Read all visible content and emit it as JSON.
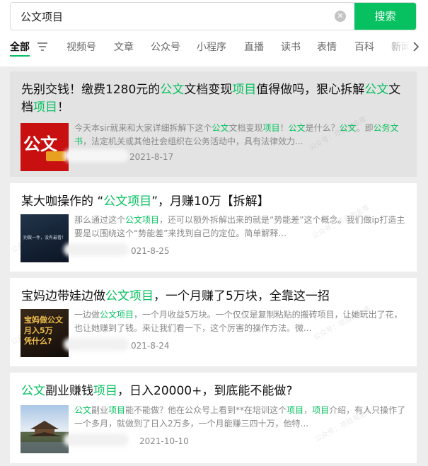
{
  "search": {
    "value": "公文项目",
    "button_label": "搜索"
  },
  "tabs": [
    "全部",
    "视频号",
    "文章",
    "公众号",
    "小程序",
    "直播",
    "读书",
    "表情",
    "百科",
    "新闻"
  ],
  "accent_color": "#07c160",
  "results": [
    {
      "title": [
        [
          "先别交钱！缴费1280元的",
          false
        ],
        [
          "公文",
          true
        ],
        [
          "文档变现",
          false
        ],
        [
          "项目",
          true
        ],
        [
          "值得做吗，狠心拆解",
          false
        ],
        [
          "公文",
          true
        ],
        [
          "文档",
          false
        ],
        [
          "项目",
          true
        ],
        [
          "！",
          false
        ]
      ],
      "desc": [
        [
          "今天本sir就来和大家详细拆解下这个",
          false
        ],
        [
          "公文",
          true
        ],
        [
          "文档变现",
          false
        ],
        [
          "项目",
          true
        ],
        [
          "！",
          false
        ],
        [
          "公文",
          true
        ],
        [
          "是什么？",
          false
        ],
        [
          "公文",
          true
        ],
        [
          "。即",
          false
        ],
        [
          "公务文书",
          true
        ],
        [
          "，法定机关或其他社会组织在公务活动中，具有法律效力...",
          false
        ]
      ],
      "date": "2021-8-17",
      "thumb_text": "公文"
    },
    {
      "title": [
        [
          "某大咖操作的 “",
          false
        ],
        [
          "公文项目",
          true
        ],
        [
          "”，月赚10万【拆解】",
          false
        ]
      ],
      "desc": [
        [
          "那么通过这个",
          false
        ],
        [
          "公文项目",
          true
        ],
        [
          "，还可以额外拆解出来的就是“势能差”这个概念。我们做ip打造主要是以围绕这个“势能差”来找到自己的定位。简单解释...",
          false
        ]
      ],
      "date": "021-8-25",
      "thumb_text": "别做一件，没有最看！"
    },
    {
      "title": [
        [
          "宝妈边带娃边做",
          false
        ],
        [
          "公文项目",
          true
        ],
        [
          "，一个月赚了5万块，全靠这一招",
          false
        ]
      ],
      "desc": [
        [
          "一边做",
          false
        ],
        [
          "公文项目",
          true
        ],
        [
          "，一个月收益5万块。一个仅仅是复制粘贴的搬砖项目，让她玩出了花，也让她赚到了钱。来让我们看一下，这个厉害的操作方法。微...",
          false
        ]
      ],
      "date": "021-8-24",
      "thumb_text": "宝妈做公文\n月入5万\n凭什么?"
    },
    {
      "title": [
        [
          "公文",
          true
        ],
        [
          "副业赚钱",
          false
        ],
        [
          "项目",
          true
        ],
        [
          "，日入20000+，到底能不能做?",
          false
        ]
      ],
      "desc": [
        [
          "公文",
          true
        ],
        [
          "副业",
          false
        ],
        [
          "项目",
          true
        ],
        [
          "能不能做？他在公众号上看到**在培训这个",
          false
        ],
        [
          "项目",
          true
        ],
        [
          "，",
          false
        ],
        [
          "项目",
          true
        ],
        [
          "介绍，有人只操作了一个多月，就做到了日入2万多，一个月能赚三四十万，他特...",
          false
        ]
      ],
      "date": "2021-10-10",
      "thumb_text": ""
    }
  ],
  "watermark": "公众号：项目淘金库"
}
